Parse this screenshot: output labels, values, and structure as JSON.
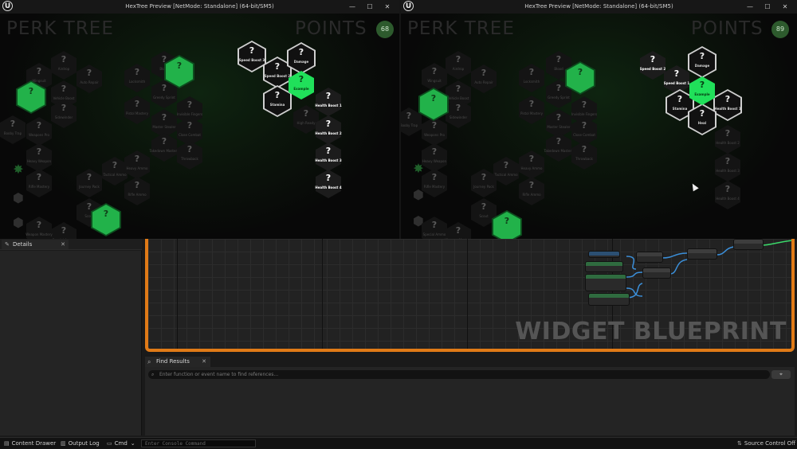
{
  "windows": [
    {
      "title": "HexTree Preview [NetMode: Standalone]  (64-bit/SM5)",
      "game_title": "PERK TREE",
      "points_label": "POINTS",
      "points": "68",
      "hexes": [
        {
          "s": "locked",
          "label": "Airdrop"
        },
        {
          "s": "locked",
          "label": "Wingsuit"
        },
        {
          "s": "locked",
          "label": "Auto Repair"
        },
        {
          "s": "locked",
          "label": "Vehicle Boost"
        },
        {
          "s": "locked",
          "label": "Locksmith"
        },
        {
          "s": "locked",
          "label": "Blood"
        },
        {
          "s": "locked",
          "label": "Sidewinder"
        },
        {
          "s": "locked",
          "label": "Booby Trap"
        },
        {
          "s": "locked",
          "label": "Weapons Pro"
        },
        {
          "s": "locked",
          "label": "Pistol Mastery"
        },
        {
          "s": "locked",
          "label": "Greedy Sprint"
        },
        {
          "s": "locked",
          "label": "Invisible Fingers"
        },
        {
          "s": "locked",
          "label": "Master Stealer"
        },
        {
          "s": "locked",
          "label": "Close Combat"
        },
        {
          "s": "locked",
          "label": "Takedown Mastery"
        },
        {
          "s": "locked",
          "label": "Heavy Weapon"
        },
        {
          "s": "locked",
          "label": "Rifle Mastery"
        },
        {
          "s": "locked",
          "label": "Throwback"
        },
        {
          "s": "locked",
          "label": "Tactical Ammo"
        },
        {
          "s": "locked",
          "label": "Heavy Ammo"
        },
        {
          "s": "locked",
          "label": "Journey Pack"
        },
        {
          "s": "locked",
          "label": "Rifle Ammo"
        },
        {
          "s": "locked",
          "label": "Scout"
        },
        {
          "s": "locked",
          "label": "Special Ammo"
        },
        {
          "s": "locked",
          "label": "Weapon Mastery"
        },
        {
          "s": "locked",
          "label": "High Ready"
        },
        {
          "s": "ring",
          "label": "Speed Boost 3"
        },
        {
          "s": "ring",
          "label": "Speed Boost 2"
        },
        {
          "s": "ring",
          "label": "Damage"
        },
        {
          "s": "ring",
          "label": "Stamina"
        },
        {
          "s": "white",
          "label": "Health Boost 1"
        },
        {
          "s": "white",
          "label": "Health Boost 2"
        },
        {
          "s": "white",
          "label": "Health Boost 3"
        },
        {
          "s": "white",
          "label": "Health Boost 4"
        },
        {
          "s": "greenbig",
          "label": ""
        },
        {
          "s": "greenbig",
          "label": ""
        },
        {
          "s": "greenbig",
          "label": ""
        },
        {
          "s": "greenbig",
          "label": ""
        },
        {
          "s": "brightgreen",
          "label": "Example"
        }
      ]
    },
    {
      "title": "HexTree Preview [NetMode: Standalone]  (64-bit/SM5)",
      "game_title": "PERK TREE",
      "points_label": "POINTS",
      "points": "89",
      "hexes": [
        {
          "s": "locked",
          "label": "Airdrop"
        },
        {
          "s": "locked",
          "label": "Wingsuit"
        },
        {
          "s": "locked",
          "label": "Auto Repair"
        },
        {
          "s": "locked",
          "label": "Vehicle Boost"
        },
        {
          "s": "locked",
          "label": "Locksmith"
        },
        {
          "s": "locked",
          "label": "Blood"
        },
        {
          "s": "locked",
          "label": "Sidewinder"
        },
        {
          "s": "locked",
          "label": "Booby Trap"
        },
        {
          "s": "locked",
          "label": "Weapons Pro"
        },
        {
          "s": "locked",
          "label": "Pistol Mastery"
        },
        {
          "s": "locked",
          "label": "Greedy Sprint"
        },
        {
          "s": "locked",
          "label": "Invisible Fingers"
        },
        {
          "s": "locked",
          "label": "Master Stealer"
        },
        {
          "s": "locked",
          "label": "Close Combat"
        },
        {
          "s": "locked",
          "label": "Takedown Mastery"
        },
        {
          "s": "locked",
          "label": "Heavy Weapon"
        },
        {
          "s": "locked",
          "label": "Rifle Mastery"
        },
        {
          "s": "locked",
          "label": "Throwback"
        },
        {
          "s": "locked",
          "label": "Tactical Ammo"
        },
        {
          "s": "locked",
          "label": "Heavy Ammo"
        },
        {
          "s": "locked",
          "label": "Journey Pack"
        },
        {
          "s": "locked",
          "label": "Rifle Ammo"
        },
        {
          "s": "locked",
          "label": "Scout"
        },
        {
          "s": "locked",
          "label": "Special Ammo"
        },
        {
          "s": "locked",
          "label": "Weapon Mastery"
        },
        {
          "s": "white",
          "label": "Speed Boost 2"
        },
        {
          "s": "white",
          "label": "Speed Boost 1"
        },
        {
          "s": "ring",
          "label": "Damage"
        },
        {
          "s": "ring",
          "label": "Stamina"
        },
        {
          "s": "ring",
          "label": "Health Boost 1"
        },
        {
          "s": "ring",
          "label": "Heal"
        },
        {
          "s": "locked",
          "label": "Health Boost 2"
        },
        {
          "s": "locked",
          "label": "Health Boost 3"
        },
        {
          "s": "locked",
          "label": "Health Boost 4"
        },
        {
          "s": "greenbig",
          "label": ""
        },
        {
          "s": "greenbig",
          "label": ""
        },
        {
          "s": "greenbig",
          "label": ""
        },
        {
          "s": "brightgreen",
          "label": "Example"
        }
      ]
    }
  ],
  "window_buttons": {
    "minimize": "—",
    "maximize": "☐",
    "close": "✕"
  },
  "details": {
    "tab_label": "Details",
    "close": "✕"
  },
  "graph": {
    "watermark": "WIDGET BLUEPRINT"
  },
  "find_results": {
    "tab_label": "Find Results",
    "close": "✕",
    "placeholder": "Enter function or event name to find references...",
    "button_icon": "binoculars-icon"
  },
  "statusbar": {
    "content_drawer": "Content Drawer",
    "output_log": "Output Log",
    "cmd": "Cmd",
    "console_placeholder": "Enter Console Command",
    "source_control": "Source Control Off"
  },
  "colors": {
    "accent_orange": "#e07a17",
    "hex_green": "#1fbf48",
    "bright_green": "#20e05a"
  }
}
